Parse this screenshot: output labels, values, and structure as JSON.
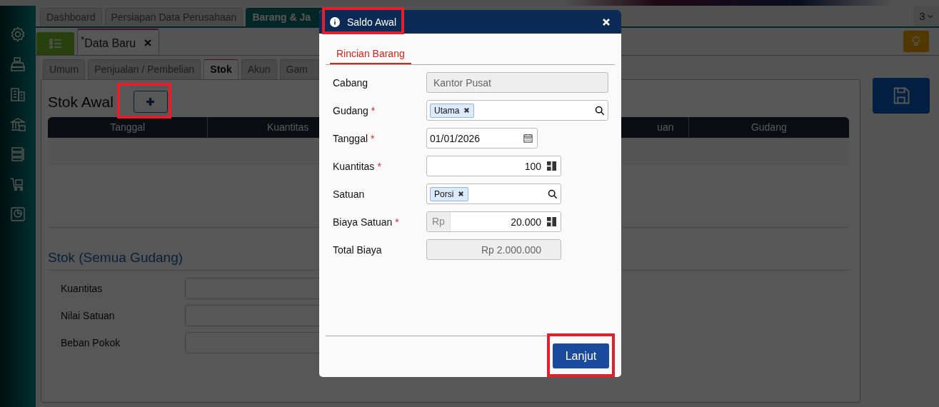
{
  "top_tabs": [
    {
      "label": "Dashboard",
      "selected": false
    },
    {
      "label": "Persiapan Data Perusahaan",
      "selected": false
    },
    {
      "label": "Barang & Ja",
      "selected": true
    }
  ],
  "tab_counter": "3",
  "doc_tab": {
    "label": "$^{*}$Data Baru"
  },
  "section_tabs": [
    {
      "label": "Umum",
      "selected": false
    },
    {
      "label": "Penjualan / Pembelian",
      "selected": false
    },
    {
      "label": "Stok",
      "selected": true
    },
    {
      "label": "Akun",
      "selected": false
    },
    {
      "label": "Gam",
      "selected": false
    }
  ],
  "stok_awal": {
    "title": "Stok Awal",
    "columns": [
      {
        "label": "Tanggal"
      },
      {
        "label": "Kuantitas"
      },
      {
        "label": "uan"
      },
      {
        "label": "Gudang"
      }
    ]
  },
  "summary": {
    "title": "Stok (Semua Gudang)",
    "fields": [
      {
        "label": "Kuantitas"
      },
      {
        "label": "Nilai Satuan"
      },
      {
        "label": "Beban Pokok"
      }
    ]
  },
  "dialog": {
    "title": "Saldo Awal",
    "tabs": [
      {
        "label": "Rincian Barang",
        "selected": true
      }
    ],
    "fields": [
      {
        "kind": "readonly",
        "label": "Cabang",
        "value": "Kantor Pusat"
      },
      {
        "kind": "lookup",
        "label": "Gudang",
        "mark": "*",
        "tag": "Utama"
      },
      {
        "kind": "date",
        "label": "Tanggal",
        "mark": "*",
        "value": "01/01/2026"
      },
      {
        "kind": "number",
        "label": "Kuantitas",
        "mark": "*",
        "value": "100"
      },
      {
        "kind": "lookup",
        "label": "Satuan",
        "tag": "Porsi"
      },
      {
        "kind": "currency",
        "label": "Biaya Satuan",
        "mark": "*",
        "prefix": "Rp",
        "value": "20.000"
      },
      {
        "kind": "total",
        "label": "Total Biaya",
        "value": "Rp 2.000.000"
      }
    ],
    "button": "Lanjut"
  }
}
